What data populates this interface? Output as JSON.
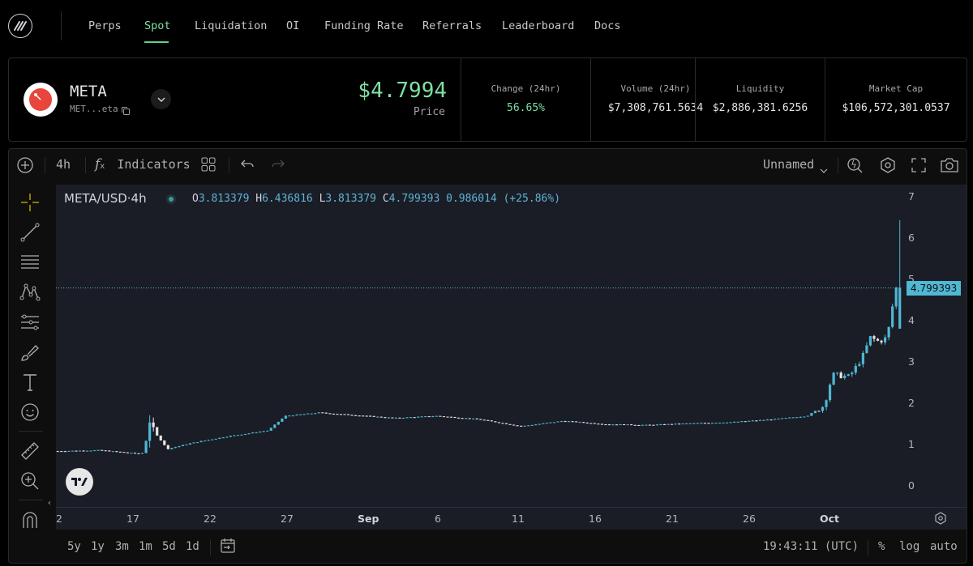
{
  "nav": {
    "logo_icon": "logo-icon",
    "items": [
      {
        "label": "Perps"
      },
      {
        "label": "Spot"
      },
      {
        "label": "Liquidation"
      },
      {
        "label": "OI"
      },
      {
        "label": "Funding Rate"
      },
      {
        "label": "Referrals"
      },
      {
        "label": "Leaderboard"
      },
      {
        "label": "Docs"
      }
    ],
    "active": "Spot"
  },
  "token": {
    "name": "META",
    "address_short": "MET...eta",
    "price": "$4.7994",
    "price_label": "Price"
  },
  "stats": [
    {
      "label": "Change (24hr)",
      "value": "56.65%",
      "color": "#7ee0a3"
    },
    {
      "label": "Volume (24hr)",
      "value": "$7,308,761.5634"
    },
    {
      "label": "Liquidity",
      "value": "$2,886,381.6256"
    },
    {
      "label": "Market Cap",
      "value": "$106,572,301.0537"
    }
  ],
  "chart_toolbar": {
    "interval": "4h",
    "indicators": "Indicators",
    "layout_name": "Unnamed"
  },
  "legend": {
    "symbol": "META/USD·4h",
    "o_label": "O",
    "o": "3.813379",
    "h_label": "H",
    "h": "6.436816",
    "l_label": "L",
    "l": "3.813379",
    "c_label": "C",
    "c": "4.799393",
    "change": "0.986014",
    "change_pct": "(+25.86%)"
  },
  "colors": {
    "up": "#4fb8d4",
    "down": "#e6e6e6",
    "accent": "#7ee0a3",
    "price_line": "#4fb8d4"
  },
  "bottom_bar": {
    "ranges": [
      "5y",
      "1y",
      "3m",
      "1m",
      "5d",
      "1d"
    ],
    "time": "19:43:11 (UTC)",
    "pct": "%",
    "log": "log",
    "auto": "auto"
  },
  "chart_data": {
    "type": "candlestick",
    "title": "",
    "symbol": "META/USD",
    "interval": "4h",
    "ylim": [
      -0.5,
      7.3
    ],
    "yticks": [
      0,
      1,
      2,
      3,
      4,
      5,
      6,
      7
    ],
    "last_price": 4.799393,
    "xticks": [
      "2",
      "17",
      "22",
      "27",
      "Sep",
      "6",
      "11",
      "16",
      "21",
      "26",
      "Oct"
    ],
    "xtick_bold": [
      "Sep",
      "Oct"
    ],
    "close_path_approx": [
      {
        "t": 0,
        "v": 0.85
      },
      {
        "t": 0.05,
        "v": 0.87
      },
      {
        "t": 0.1,
        "v": 0.78
      },
      {
        "t": 0.11,
        "v": 1.45
      },
      {
        "t": 0.13,
        "v": 0.9
      },
      {
        "t": 0.16,
        "v": 1.05
      },
      {
        "t": 0.2,
        "v": 1.2
      },
      {
        "t": 0.25,
        "v": 1.35
      },
      {
        "t": 0.27,
        "v": 1.7
      },
      {
        "t": 0.31,
        "v": 1.78
      },
      {
        "t": 0.4,
        "v": 1.65
      },
      {
        "t": 0.45,
        "v": 1.7
      },
      {
        "t": 0.5,
        "v": 1.62
      },
      {
        "t": 0.55,
        "v": 1.45
      },
      {
        "t": 0.6,
        "v": 1.58
      },
      {
        "t": 0.65,
        "v": 1.5
      },
      {
        "t": 0.7,
        "v": 1.48
      },
      {
        "t": 0.75,
        "v": 1.52
      },
      {
        "t": 0.8,
        "v": 1.55
      },
      {
        "t": 0.85,
        "v": 1.62
      },
      {
        "t": 0.89,
        "v": 1.7
      },
      {
        "t": 0.91,
        "v": 1.95
      },
      {
        "t": 0.92,
        "v": 2.7
      },
      {
        "t": 0.94,
        "v": 2.65
      },
      {
        "t": 0.955,
        "v": 3.1
      },
      {
        "t": 0.965,
        "v": 3.6
      },
      {
        "t": 0.975,
        "v": 3.5
      },
      {
        "t": 0.985,
        "v": 3.6
      },
      {
        "t": 0.995,
        "v": 4.8
      }
    ],
    "last_candle": {
      "o": 3.813379,
      "h": 6.436816,
      "l": 3.813379,
      "c": 4.799393
    }
  }
}
